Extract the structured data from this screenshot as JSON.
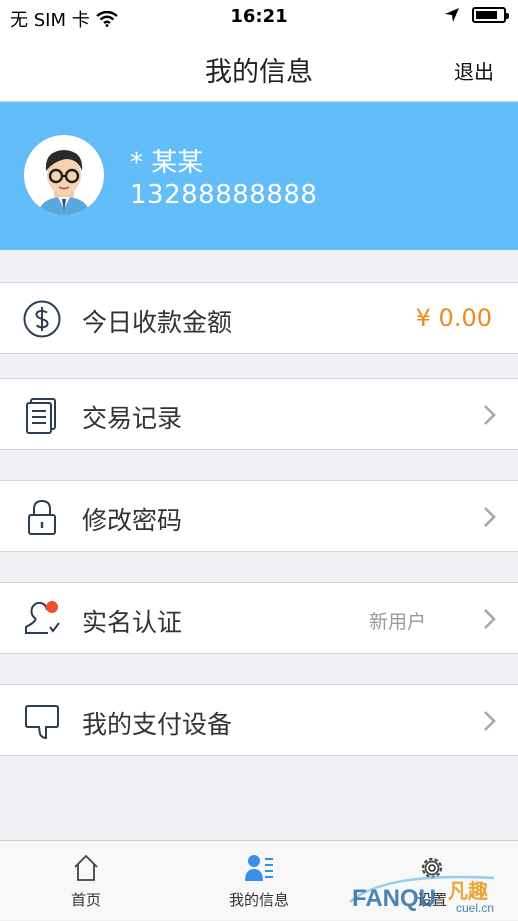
{
  "status_bar": {
    "carrier": "无 SIM 卡",
    "time": "16:21",
    "battery_level": 0.8
  },
  "nav": {
    "title": "我的信息",
    "logout_label": "退出"
  },
  "profile": {
    "name": "* 某某",
    "phone": "13288888888"
  },
  "today_income": {
    "label": "今日收款金额",
    "value": "¥ 0.00"
  },
  "menu": {
    "transactions": {
      "label": "交易记录"
    },
    "change_password": {
      "label": "修改密码"
    },
    "verification": {
      "label": "实名认证",
      "tag": "新用户"
    },
    "devices": {
      "label": "我的支付设备"
    }
  },
  "tabs": {
    "home": {
      "label": "首页",
      "icon": "home-icon"
    },
    "my_info": {
      "label": "我的信息",
      "icon": "user-list-icon"
    },
    "settings": {
      "label": "设置",
      "icon": "gear-icon"
    }
  },
  "watermark": {
    "brand": "FANQU",
    "text": "凡趣",
    "site": "cuel.cn"
  },
  "colors": {
    "accent": "#62bdf9",
    "money": "#f08a1c",
    "tab_active": "#3a8ee6"
  }
}
